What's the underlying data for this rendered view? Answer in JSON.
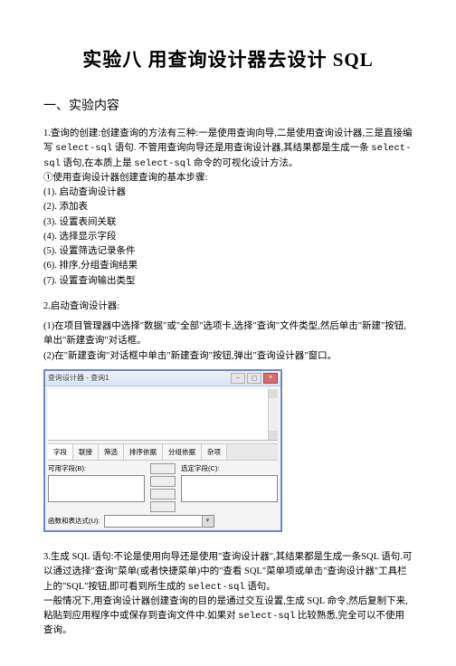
{
  "title": "实验八 用查询设计器去设计 SQL",
  "section1": {
    "heading": "一、实验内容",
    "p1a": "1.查询的创建:创建查询的方法有三种:一是使用查询向导,二是使用查询设计器,三是直接编写 ",
    "p1_code1": "select-sql",
    "p1b": " 语句. 不管用查询向导还是用查询设计器,其结果都是生成一条 ",
    "p1_code2": "select-sql",
    "p1c": " 语句,在本质上是 ",
    "p1_code3": "select-sql",
    "p1d": " 命令的可视化设计方法。",
    "p2": "①使用查询设计器创建查询的基本步骤:",
    "steps": [
      "(1). 启动查询设计器",
      "(2). 添加表",
      "(3). 设置表间关联",
      "(4). 选择显示字段",
      "(5). 设置筛选记录条件",
      "(6). 排序,分组查询结果",
      "(7). 设置查询输出类型"
    ],
    "p3head": "2.启动查询设计器:",
    "p3a": "(1)在项目管理器中选择\"数据\"或\"全部\"选项卡,选择\"查询\"文件类型,然后单击\"新建\"按钮,单出\"新建查询\"对话框。",
    "p3b": "(2)在\"新建查询\"对话框中单击\"新建查询\"按钮,弹出\"查询设计器\"窗口。"
  },
  "screenshot": {
    "window_title": "查询设计器 - 查询1",
    "tabs": [
      "字段",
      "联接",
      "筛选",
      "排序依据",
      "分组依据",
      "杂项"
    ],
    "left_label": "可用字段(B):",
    "right_label": "选定字段(C):",
    "bottom_label": "函数和表达式(U):"
  },
  "section3": {
    "p1a": "3.生成 SQL 语句:不论是使用向导还是使用\"查询设计器\",其结果都是生成一条SQL 语句.可以通过选择\"查询\"菜单(或者快捷菜单)中的\"查看 SQL\"菜单项或单击\"查询设计器\"工具栏上的\"SQL\"按钮,即可看到所生成的 ",
    "p1_code1": "select-sql",
    "p1b": " 语句。",
    "p2a": "一般情况下,用查询设计器创建查询的目的是通过交互设置,生成 SQL 命令,然后复制下来,粘贴到应用程序中或保存到查询文件中.如果对 ",
    "p2_code1": "select-sql",
    "p2b": " 比较熟悉,完全可以不使用查询。"
  }
}
